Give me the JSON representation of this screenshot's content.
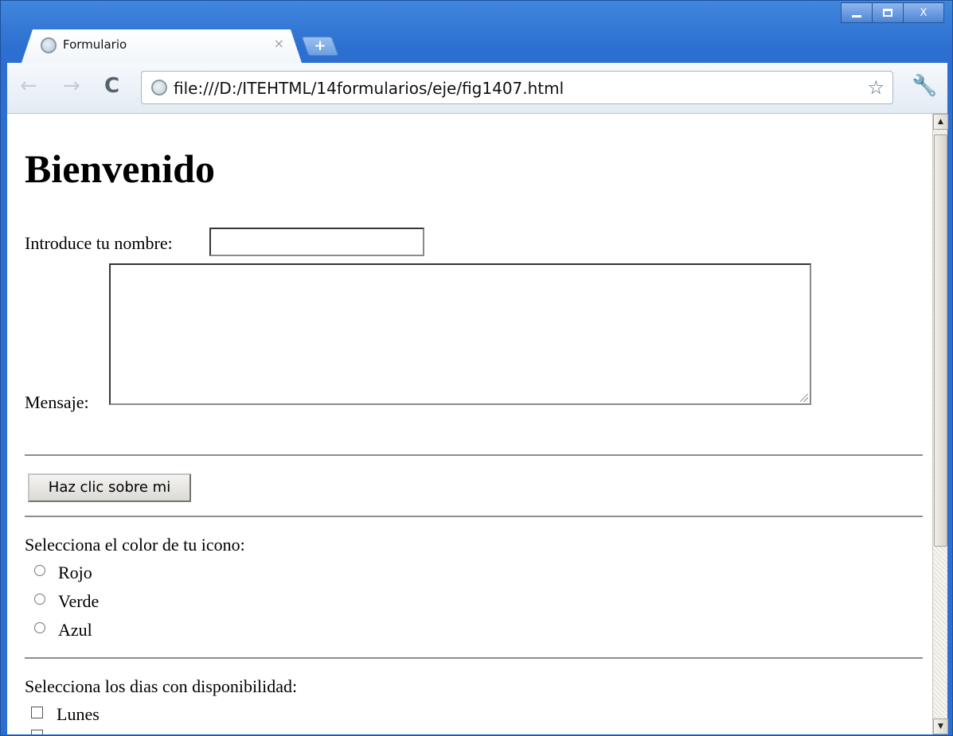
{
  "browser": {
    "tab_title": "Formulario",
    "tab_close": "×",
    "new_tab": "+",
    "url": "file:///D:/ITEHTML/14formularios/eje/fig1407.html",
    "back_icon": "arrow-left",
    "forward_icon": "arrow-right",
    "reload_icon": "reload",
    "star_icon": "star-outline",
    "wrench_icon": "wrench",
    "close_glyph": "X"
  },
  "page": {
    "heading": "Bienvenido",
    "name_label": "Introduce tu nombre:",
    "name_value": "",
    "message_label": "Mensaje:",
    "message_value": "",
    "button_label": "Haz clic sobre mi",
    "color_prompt": "Selecciona el color de tu icono:",
    "colors": [
      "Rojo",
      "Verde",
      "Azul"
    ],
    "days_prompt": "Selecciona los dias con disponibilidad:",
    "days": [
      "Lunes"
    ]
  }
}
